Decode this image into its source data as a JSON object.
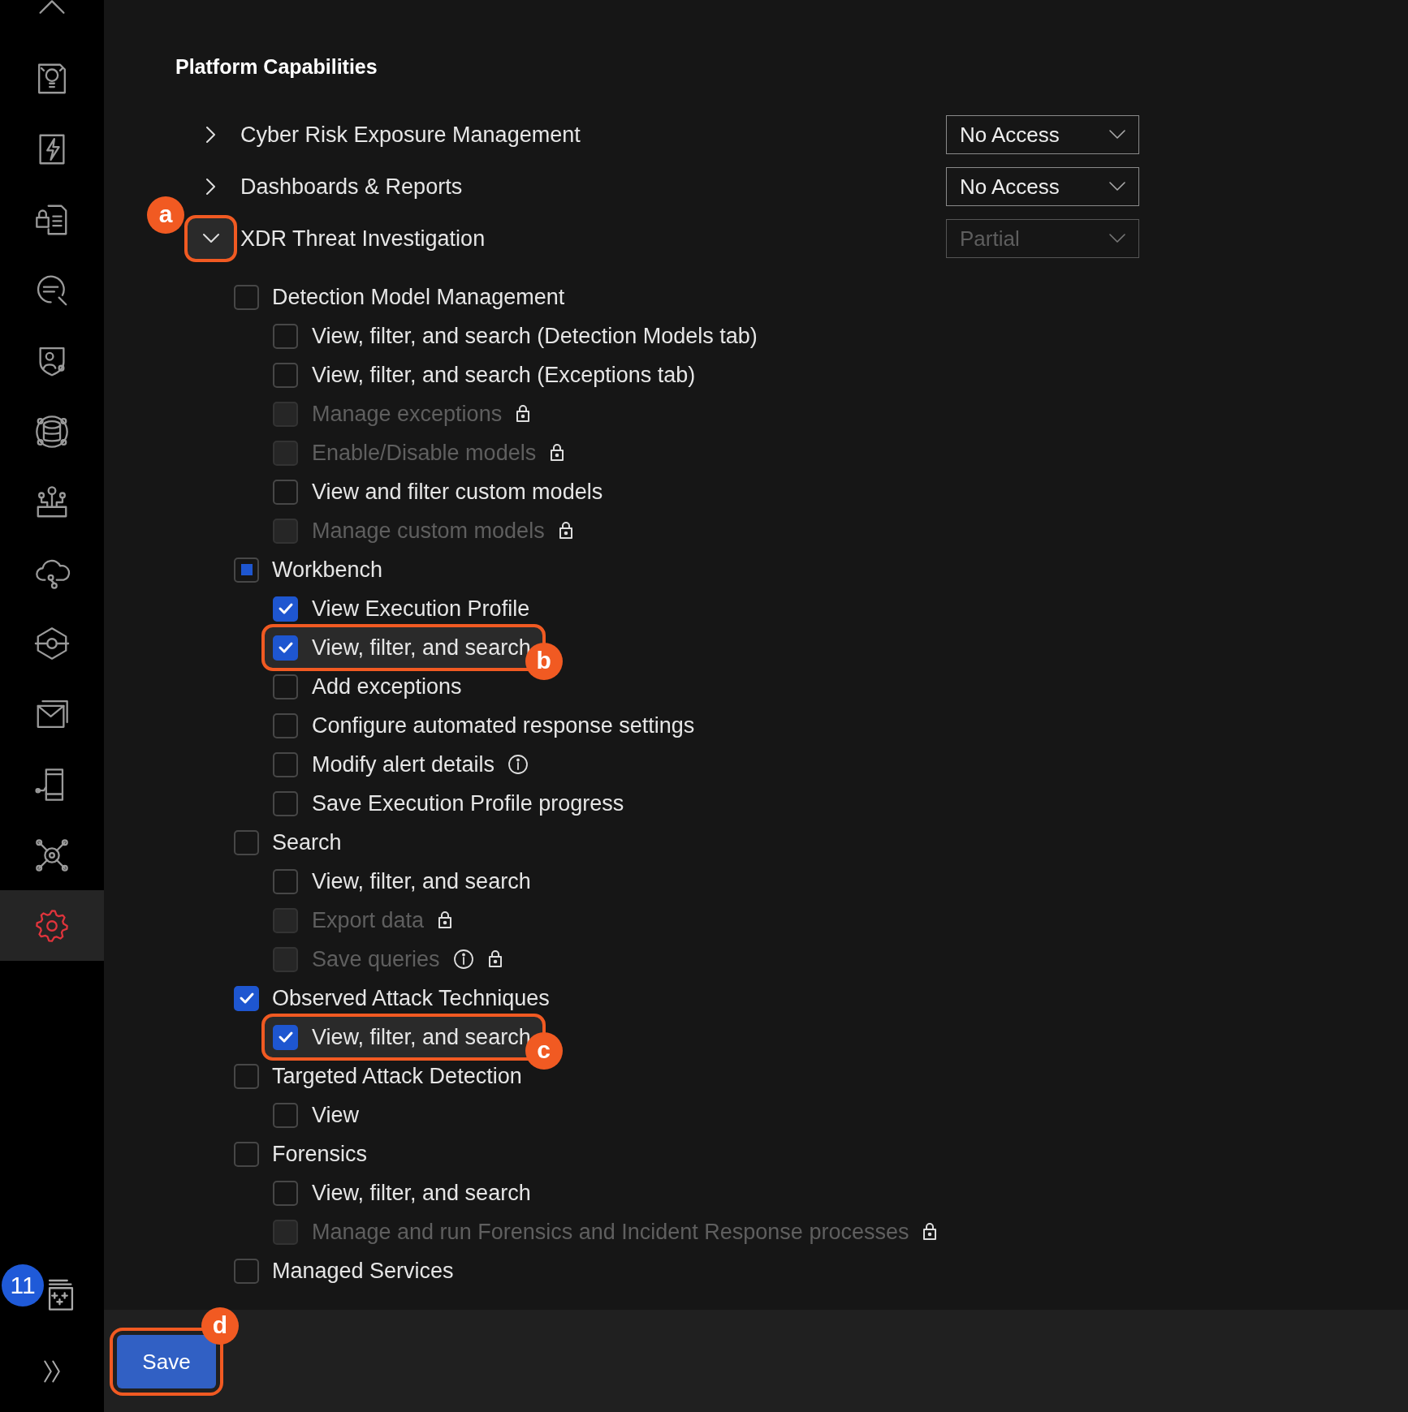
{
  "title": "Platform Capabilities",
  "sidebar": {
    "items": [
      {
        "selected": false
      },
      {
        "selected": false
      },
      {
        "selected": false
      },
      {
        "selected": false
      },
      {
        "selected": false
      },
      {
        "selected": false
      },
      {
        "selected": false
      },
      {
        "selected": false
      },
      {
        "selected": false
      },
      {
        "selected": false
      },
      {
        "selected": false
      },
      {
        "selected": false
      },
      {
        "selected": false
      },
      {
        "selected": true
      }
    ],
    "notification_count": "11"
  },
  "capabilities": [
    {
      "label": "Cyber Risk Exposure Management",
      "expanded": false,
      "access": "No Access",
      "access_disabled": false
    },
    {
      "label": "Dashboards & Reports",
      "expanded": false,
      "access": "No Access",
      "access_disabled": false
    },
    {
      "label": "XDR Threat Investigation",
      "expanded": true,
      "callout": "a",
      "access": "Partial",
      "access_disabled": true,
      "groups": [
        {
          "label": "Detection Model Management",
          "checked": false,
          "indeterminate": false,
          "items": [
            {
              "label": "View, filter, and search (Detection Models tab)",
              "checked": false,
              "disabled": false,
              "info": false,
              "locked": false
            },
            {
              "label": "View, filter, and search (Exceptions tab)",
              "checked": false,
              "disabled": false,
              "info": false,
              "locked": false
            },
            {
              "label": "Manage exceptions",
              "checked": false,
              "disabled": true,
              "info": false,
              "locked": true
            },
            {
              "label": "Enable/Disable models",
              "checked": false,
              "disabled": true,
              "info": false,
              "locked": true
            },
            {
              "label": "View and filter custom models",
              "checked": false,
              "disabled": false,
              "info": false,
              "locked": false
            },
            {
              "label": "Manage custom models",
              "checked": false,
              "disabled": true,
              "info": false,
              "locked": true
            }
          ]
        },
        {
          "label": "Workbench",
          "checked": false,
          "indeterminate": true,
          "items": [
            {
              "label": "View Execution Profile",
              "checked": true,
              "disabled": false,
              "info": false,
              "locked": false
            },
            {
              "label": "View, filter, and search",
              "checked": true,
              "disabled": false,
              "info": false,
              "locked": false,
              "callout": "b"
            },
            {
              "label": "Add exceptions",
              "checked": false,
              "disabled": false,
              "info": false,
              "locked": false
            },
            {
              "label": "Configure automated response settings",
              "checked": false,
              "disabled": false,
              "info": false,
              "locked": false
            },
            {
              "label": "Modify alert details",
              "checked": false,
              "disabled": false,
              "info": true,
              "locked": false
            },
            {
              "label": "Save Execution Profile progress",
              "checked": false,
              "disabled": false,
              "info": false,
              "locked": false
            }
          ]
        },
        {
          "label": "Search",
          "checked": false,
          "indeterminate": false,
          "items": [
            {
              "label": "View, filter, and search",
              "checked": false,
              "disabled": false,
              "info": false,
              "locked": false
            },
            {
              "label": "Export data",
              "checked": false,
              "disabled": true,
              "info": false,
              "locked": true
            },
            {
              "label": "Save queries",
              "checked": false,
              "disabled": true,
              "info": true,
              "locked": true
            }
          ]
        },
        {
          "label": "Observed Attack Techniques",
          "checked": true,
          "indeterminate": false,
          "items": [
            {
              "label": "View, filter, and search",
              "checked": true,
              "disabled": false,
              "info": false,
              "locked": false,
              "callout": "c"
            }
          ]
        },
        {
          "label": "Targeted Attack Detection",
          "checked": false,
          "indeterminate": false,
          "items": [
            {
              "label": "View",
              "checked": false,
              "disabled": false,
              "info": false,
              "locked": false
            }
          ]
        },
        {
          "label": "Forensics",
          "checked": false,
          "indeterminate": false,
          "items": [
            {
              "label": "View, filter, and search",
              "checked": false,
              "disabled": false,
              "info": false,
              "locked": false
            },
            {
              "label": "Manage and run Forensics and Incident Response processes",
              "checked": false,
              "disabled": true,
              "info": false,
              "locked": true
            }
          ]
        },
        {
          "label": "Managed Services",
          "checked": false,
          "indeterminate": false
        }
      ]
    }
  ],
  "save_button": {
    "label": "Save",
    "callout": "d"
  }
}
